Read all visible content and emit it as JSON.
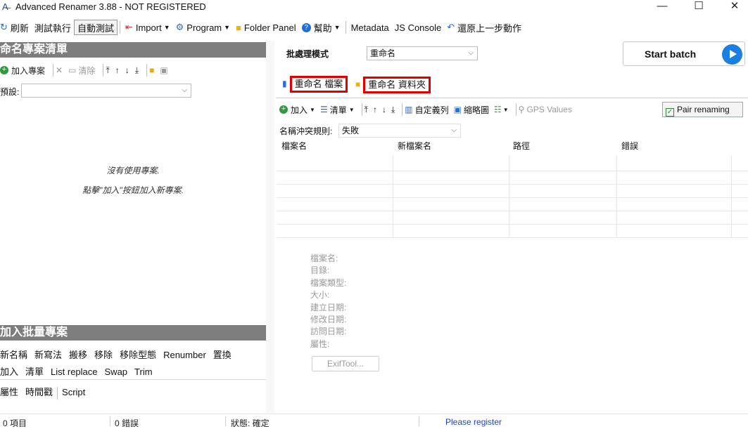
{
  "window": {
    "title": "Advanced Renamer 3.88 - NOT REGISTERED",
    "minimize": "—",
    "maximize": "☐",
    "close": "✕"
  },
  "toolbar": {
    "refresh": "刷新",
    "test_run": "測試執行",
    "auto_test": "自動測試",
    "import": "Import",
    "program": "Program",
    "folder_panel": "Folder Panel",
    "help": "幫助",
    "metadata": "Metadata",
    "js_console": "JS Console",
    "undo": "還原上一步動作"
  },
  "left_panel": {
    "header": "命名專案清單",
    "add_project": "加入專案",
    "clear": "清除",
    "preset_label": "預設:",
    "empty_line1": "沒有使用專案.",
    "empty_line2": "點擊\"加入\"按鈕加入新專案.",
    "batch_header": "加入批量專案",
    "methods_row1": [
      "新名稱",
      "新寫法",
      "搬移",
      "移除",
      "移除型態",
      "Renumber",
      "置換"
    ],
    "methods_row2": [
      "加入",
      "清單",
      "List replace",
      "Swap",
      "Trim"
    ],
    "methods_row3": [
      "屬性",
      "時間戳",
      "Script"
    ]
  },
  "right_panel": {
    "mode_label": "批處理模式",
    "mode_value": "重命名",
    "start_batch": "Start batch",
    "tab_files": "重命名 檔案",
    "tab_folders": "重命名 資料夾",
    "toolbar": {
      "add": "加入",
      "clear": "清單",
      "custom_sort": "自定義列",
      "thumbnail": "縮略圖",
      "gps": "GPS Values",
      "pair": "Pair renaming"
    },
    "conflict_label": "名稱沖突規則:",
    "conflict_value": "失敗",
    "columns": [
      "檔案名",
      "新檔案名",
      "路徑",
      "錯誤"
    ],
    "details": [
      "檔案名:",
      "目錄:",
      "檔案類型:",
      "大小:",
      "建立日期:",
      "修改日期:",
      "訪問日期:",
      "屬性:"
    ],
    "exif_button": "ExifTool..."
  },
  "status": {
    "items": "0 項目",
    "errors": "0 錯誤",
    "state": "狀態: 確定",
    "register": "Please register"
  },
  "colors": {
    "header_gray": "#7d7d7d",
    "accent_blue": "#1a7fe0",
    "highlight_red": "#e00000",
    "link_blue": "#1a44c8"
  }
}
